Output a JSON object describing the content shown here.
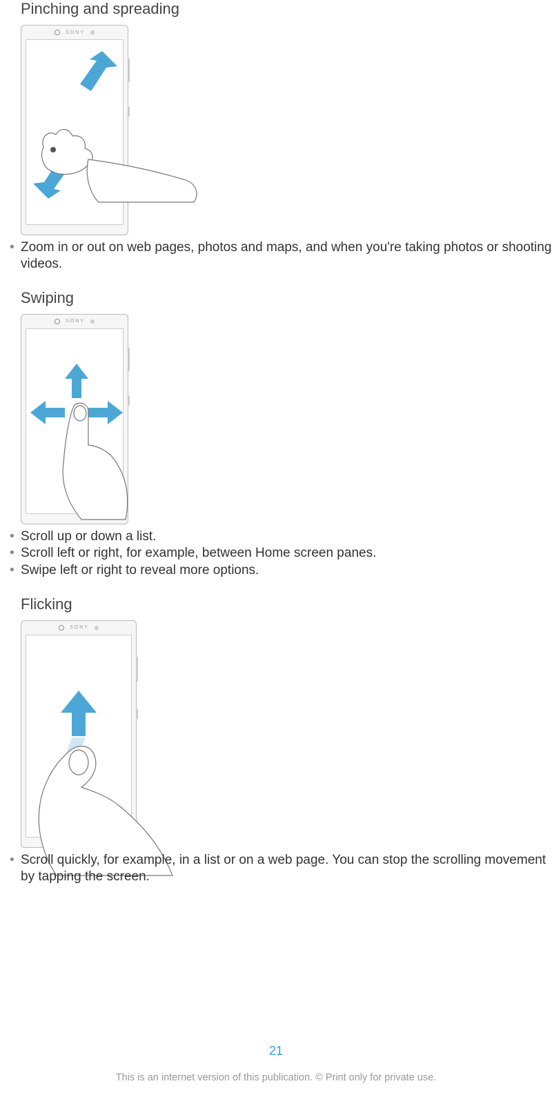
{
  "brand_label": "SONY",
  "sections": {
    "pinching": {
      "heading": "Pinching and spreading",
      "bullets": [
        "Zoom in or out on web pages, photos and maps, and when you're taking photos or shooting videos."
      ]
    },
    "swiping": {
      "heading": "Swiping",
      "bullets": [
        "Scroll up or down a list.",
        "Scroll left or right, for example, between Home screen panes.",
        "Swipe left or right to reveal more options."
      ]
    },
    "flicking": {
      "heading": "Flicking",
      "bullets": [
        "Scroll quickly, for example, in a list or on a web page. You can stop the scrolling movement by tapping the screen."
      ]
    }
  },
  "footer": {
    "page_number": "21",
    "copyright": "This is an internet version of this publication. © Print only for private use."
  },
  "colors": {
    "arrow": "#4ca7d6",
    "accent": "#2aa8d8"
  }
}
